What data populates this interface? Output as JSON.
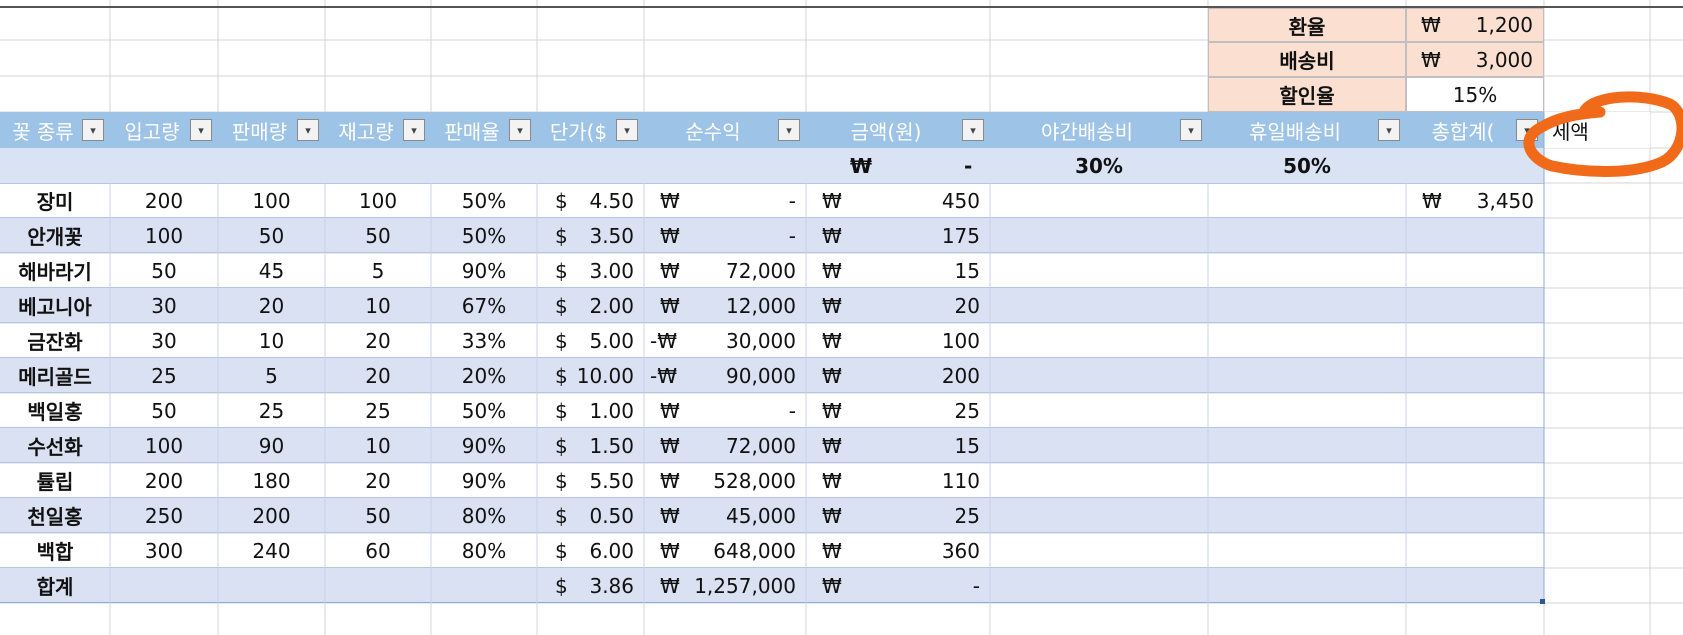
{
  "params": [
    {
      "label": "환율",
      "sym": "₩",
      "value": "1,200"
    },
    {
      "label": "배송비",
      "sym": "₩",
      "value": "3,000"
    },
    {
      "label": "할인율",
      "sym": "",
      "value": "15%"
    }
  ],
  "headers": [
    "꽃 종류",
    "입고량",
    "판매량",
    "재고량",
    "판매율",
    "단가($",
    "순수익",
    "금액(원)",
    "야간배송비",
    "휴일배송비",
    "총합계(",
    "세액"
  ],
  "subrow": {
    "won_sym": "₩",
    "won_value": "-",
    "night_pct": "30%",
    "holiday_pct": "50%"
  },
  "rows": [
    {
      "name": "장미",
      "in": "200",
      "sold": "100",
      "stock": "100",
      "rate": "50%",
      "usd": "$",
      "price": "4.50",
      "ps": "₩",
      "profit": "-",
      "as": "₩",
      "amount": "450",
      "ts": "₩",
      "total": "3,450"
    },
    {
      "name": "안개꽃",
      "in": "100",
      "sold": "50",
      "stock": "50",
      "rate": "50%",
      "usd": "$",
      "price": "3.50",
      "ps": "₩",
      "profit": "-",
      "as": "₩",
      "amount": "175",
      "ts": "",
      "total": ""
    },
    {
      "name": "해바라기",
      "in": "50",
      "sold": "45",
      "stock": "5",
      "rate": "90%",
      "usd": "$",
      "price": "3.00",
      "ps": "₩",
      "profit": "72,000",
      "as": "₩",
      "amount": "15",
      "ts": "",
      "total": ""
    },
    {
      "name": "베고니아",
      "in": "30",
      "sold": "20",
      "stock": "10",
      "rate": "67%",
      "usd": "$",
      "price": "2.00",
      "ps": "₩",
      "profit": "12,000",
      "as": "₩",
      "amount": "20",
      "ts": "",
      "total": ""
    },
    {
      "name": "금잔화",
      "in": "30",
      "sold": "10",
      "stock": "20",
      "rate": "33%",
      "usd": "$",
      "price": "5.00",
      "ps": "-₩",
      "profit": "30,000",
      "as": "₩",
      "amount": "100",
      "ts": "",
      "total": ""
    },
    {
      "name": "메리골드",
      "in": "25",
      "sold": "5",
      "stock": "20",
      "rate": "20%",
      "usd": "$",
      "price": "10.00",
      "ps": "-₩",
      "profit": "90,000",
      "as": "₩",
      "amount": "200",
      "ts": "",
      "total": ""
    },
    {
      "name": "백일홍",
      "in": "50",
      "sold": "25",
      "stock": "25",
      "rate": "50%",
      "usd": "$",
      "price": "1.00",
      "ps": "₩",
      "profit": "-",
      "as": "₩",
      "amount": "25",
      "ts": "",
      "total": ""
    },
    {
      "name": "수선화",
      "in": "100",
      "sold": "90",
      "stock": "10",
      "rate": "90%",
      "usd": "$",
      "price": "1.50",
      "ps": "₩",
      "profit": "72,000",
      "as": "₩",
      "amount": "15",
      "ts": "",
      "total": ""
    },
    {
      "name": "튤립",
      "in": "200",
      "sold": "180",
      "stock": "20",
      "rate": "90%",
      "usd": "$",
      "price": "5.50",
      "ps": "₩",
      "profit": "528,000",
      "as": "₩",
      "amount": "110",
      "ts": "",
      "total": ""
    },
    {
      "name": "천일홍",
      "in": "250",
      "sold": "200",
      "stock": "50",
      "rate": "80%",
      "usd": "$",
      "price": "0.50",
      "ps": "₩",
      "profit": "45,000",
      "as": "₩",
      "amount": "25",
      "ts": "",
      "total": ""
    },
    {
      "name": "백합",
      "in": "300",
      "sold": "240",
      "stock": "60",
      "rate": "80%",
      "usd": "$",
      "price": "6.00",
      "ps": "₩",
      "profit": "648,000",
      "as": "₩",
      "amount": "360",
      "ts": "",
      "total": ""
    },
    {
      "name": "합계",
      "in": "",
      "sold": "",
      "stock": "",
      "rate": "",
      "usd": "$",
      "price": "3.86",
      "ps": "₩",
      "profit": "1,257,000",
      "as": "₩",
      "amount": "-",
      "ts": "",
      "total": ""
    }
  ],
  "colors": {
    "header": "#9dc3e6",
    "band": "#dae3f3",
    "peach": "#fbe0d1",
    "circle": "#f06a1a"
  },
  "icons": {
    "filter": "dropdown-arrow-icon",
    "circle": "annotation-circle"
  }
}
